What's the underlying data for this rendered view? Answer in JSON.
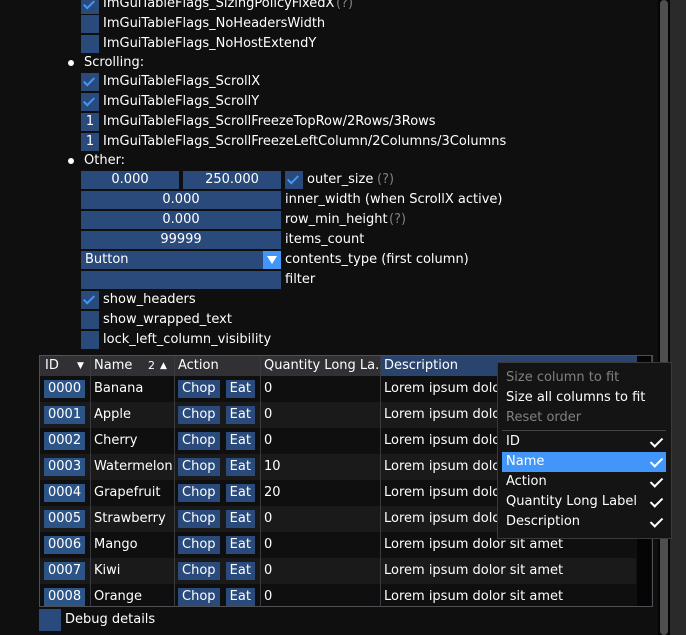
{
  "flags_top": [
    {
      "label": "ImGuiTableFlags_SizingPolicyFixedX",
      "checked": true,
      "help": "(?)"
    },
    {
      "label": "ImGuiTableFlags_NoHeadersWidth",
      "checked": false
    },
    {
      "label": "ImGuiTableFlags_NoHostExtendY",
      "checked": false
    }
  ],
  "scrolling": {
    "heading": "Scrolling:",
    "items": [
      {
        "label": "ImGuiTableFlags_ScrollX",
        "checked": true
      },
      {
        "label": "ImGuiTableFlags_ScrollY",
        "checked": true
      },
      {
        "label": "ImGuiTableFlags_ScrollFreezeTopRow/2Rows/3Rows",
        "value": "1"
      },
      {
        "label": "ImGuiTableFlags_ScrollFreezeLeftColumn/2Columns/3Columns",
        "value": "1"
      }
    ]
  },
  "other": {
    "heading": "Other:",
    "outer_size": {
      "x": "0.000",
      "y": "250.000",
      "label": "outer_size",
      "checked": true,
      "help": "(?)"
    },
    "inner_width": {
      "value": "0.000",
      "label": "inner_width (when ScrollX active)"
    },
    "row_min_height": {
      "value": "0.000",
      "label": "row_min_height",
      "help": "(?)"
    },
    "items_count": {
      "value": "99999",
      "label": "items_count"
    },
    "contents_type": {
      "value": "Button",
      "label": "contents_type (first column)"
    },
    "filter": {
      "value": "",
      "label": "filter"
    },
    "show_headers": {
      "label": "show_headers",
      "checked": true
    },
    "show_wrapped_text": {
      "label": "show_wrapped_text",
      "checked": false
    },
    "lock_left": {
      "label": "lock_left_column_visibility",
      "checked": false
    }
  },
  "table": {
    "headers": [
      "ID",
      "Name",
      "Action",
      "Quantity Long La...",
      "Description"
    ],
    "name_sort_index": "2",
    "rows": [
      {
        "id": "0000",
        "name": "Banana",
        "qty": "0",
        "desc": "Lorem ipsum dolor sit amet"
      },
      {
        "id": "0001",
        "name": "Apple",
        "qty": "0",
        "desc": "Lorem ipsum dolor sit amet"
      },
      {
        "id": "0002",
        "name": "Cherry",
        "qty": "0",
        "desc": "Lorem ipsum dolor sit amet"
      },
      {
        "id": "0003",
        "name": "Watermelon",
        "qty": "10",
        "desc": "Lorem ipsum dolor sit amet"
      },
      {
        "id": "0004",
        "name": "Grapefruit",
        "qty": "20",
        "desc": "Lorem ipsum dolor sit amet"
      },
      {
        "id": "0005",
        "name": "Strawberry",
        "qty": "0",
        "desc": "Lorem ipsum dolor sit amet"
      },
      {
        "id": "0006",
        "name": "Mango",
        "qty": "0",
        "desc": "Lorem ipsum dolor sit amet"
      },
      {
        "id": "0007",
        "name": "Kiwi",
        "qty": "0",
        "desc": "Lorem ipsum dolor sit amet"
      },
      {
        "id": "0008",
        "name": "Orange",
        "qty": "0",
        "desc": "Lorem ipsum dolor sit amet"
      }
    ],
    "chop_label": "Chop",
    "eat_label": "Eat"
  },
  "popup": {
    "size_column": "Size column to fit",
    "size_all": "Size all columns to fit",
    "reset_order": "Reset order",
    "columns": [
      "ID",
      "Name",
      "Action",
      "Quantity Long Label",
      "Description"
    ]
  },
  "debug_details": "Debug details"
}
